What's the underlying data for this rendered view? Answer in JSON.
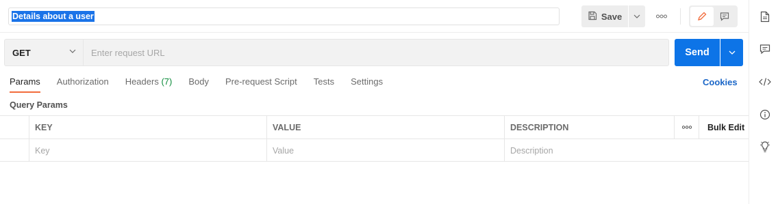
{
  "request": {
    "name": "Details about a user",
    "save_label": "Save",
    "method": "GET",
    "url_placeholder": "Enter request URL",
    "send_label": "Send"
  },
  "tabs": [
    {
      "label": "Params",
      "active": true
    },
    {
      "label": "Authorization"
    },
    {
      "label": "Headers",
      "count": "(7)"
    },
    {
      "label": "Body"
    },
    {
      "label": "Pre-request Script"
    },
    {
      "label": "Tests"
    },
    {
      "label": "Settings"
    }
  ],
  "cookies_label": "Cookies",
  "query_params": {
    "title": "Query Params",
    "columns": {
      "key": "KEY",
      "value": "VALUE",
      "description": "DESCRIPTION",
      "bulk_edit": "Bulk Edit"
    },
    "placeholders": {
      "key": "Key",
      "value": "Value",
      "description": "Description"
    }
  },
  "colors": {
    "send": "#0d74e7",
    "active_tab": "#f26b3a",
    "cookies": "#1a66c7",
    "headers_count": "#0c8b3a",
    "selection": "#1a73e8"
  },
  "icons": {
    "save": "save-icon",
    "more": "more-horizontal-icon",
    "edit": "pencil-icon",
    "comments": "comment-icon",
    "sidebar": [
      "document-icon",
      "comment-icon",
      "code-icon",
      "info-icon",
      "lightbulb-icon"
    ]
  }
}
